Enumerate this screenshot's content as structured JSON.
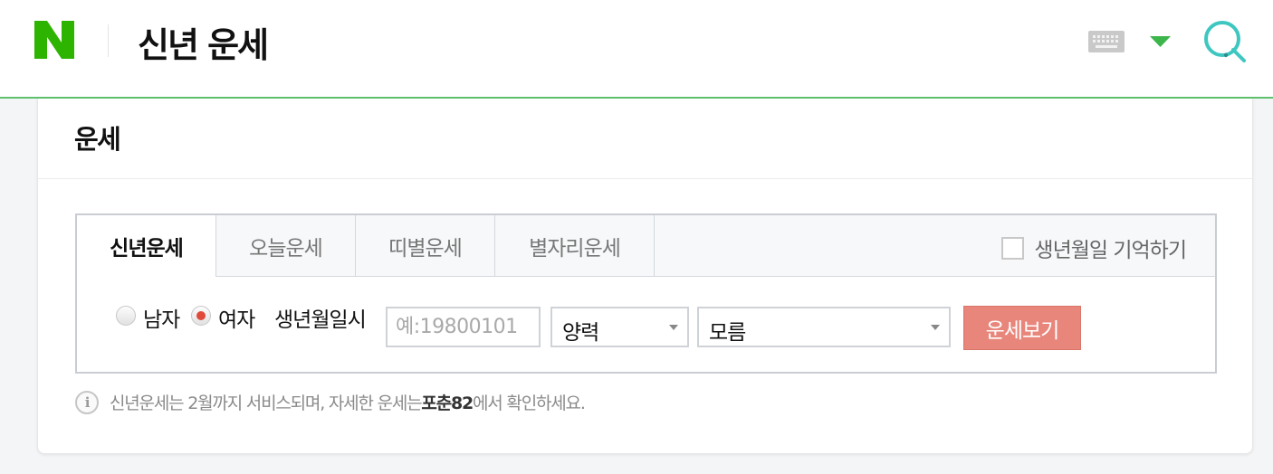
{
  "header": {
    "logo_letter": "N",
    "title": "신년 운세",
    "keyboard_icon": "keyboard-icon",
    "caret_icon": "caret-down-icon",
    "search_icon": "search-icon",
    "brand_color": "#5fc16e",
    "search_icon_color": "#3ec7c1"
  },
  "card": {
    "title": "운세",
    "tabs": [
      {
        "label": "신년운세",
        "active": true
      },
      {
        "label": "오늘운세",
        "active": false
      },
      {
        "label": "띠별운세",
        "active": false
      },
      {
        "label": "별자리운세",
        "active": false
      }
    ],
    "remember_label": "생년월일 기억하기",
    "form": {
      "gender_male": "남자",
      "gender_female": "여자",
      "selected_gender": "여자",
      "birth_label": "생년월일시",
      "birth_placeholder": "예:19800101",
      "calendar_value": "양력",
      "time_value": "모름",
      "submit_label": "운세보기",
      "submit_color": "#e8867c"
    },
    "notice": {
      "icon": "info-icon",
      "text_before": "신년운세는 2월까지 서비스되며, 자세한 운세는 ",
      "link_text": "포춘82",
      "text_after": "에서 확인하세요."
    }
  }
}
